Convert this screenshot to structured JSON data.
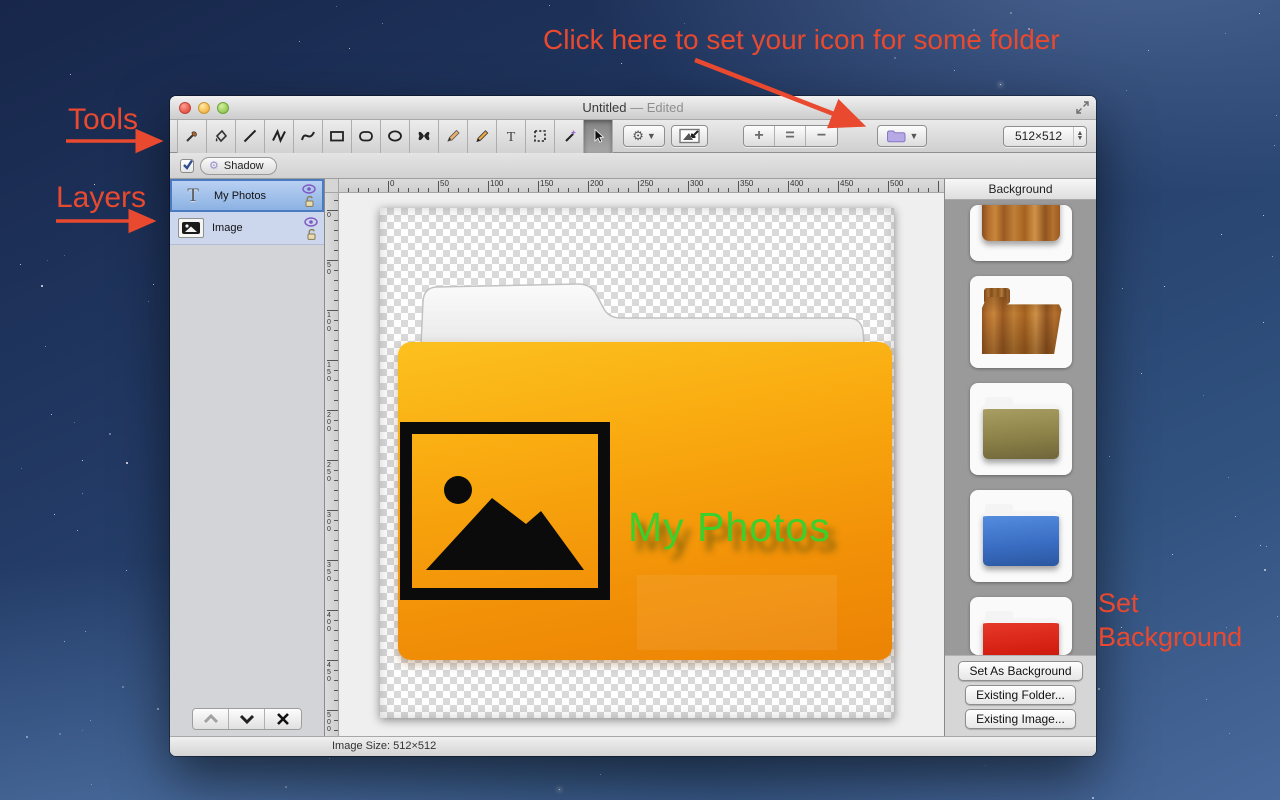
{
  "annotations": {
    "color": "#e8492f",
    "top_note": "Click here to set your icon for some folder",
    "tools_label": "Tools",
    "layers_label": "Layers",
    "set_background_label": "Set Background"
  },
  "window": {
    "title": "Untitled",
    "edited_suffix": "— Edited",
    "traffic_lights": [
      "close",
      "minimize",
      "zoom"
    ],
    "status_text": "Image Size: 512×512"
  },
  "toolbar": {
    "tools": [
      "eyedropper",
      "paint-bucket",
      "line",
      "polyline",
      "curve",
      "rectangle",
      "rounded-rectangle",
      "ellipse",
      "shapes-butterfly",
      "brush",
      "pencil",
      "text",
      "marquee-selection",
      "magic-wand",
      "move-arrow"
    ],
    "selected_tool": "move-arrow",
    "gear_menu": "gear-dropdown",
    "image_import": "image-import-button",
    "segmented_labels": [
      "+",
      "=",
      "−"
    ],
    "folder_dropdown": "folder-icon-dropdown",
    "size_value": "512×512"
  },
  "optionsbar": {
    "shadow_label": "Shadow",
    "shadow_checked": true
  },
  "layers_panel": {
    "layers": [
      {
        "name": "My Photos",
        "type": "text-layer",
        "selected": true,
        "visible": true,
        "unlocked": true
      },
      {
        "name": "Image",
        "type": "image-layer",
        "selected": false,
        "visible": true,
        "unlocked": true
      }
    ],
    "controls": [
      "move-layer-up",
      "move-layer-down",
      "delete-layer"
    ]
  },
  "canvas": {
    "ruler_ticks": [
      "0",
      "50",
      "100",
      "150",
      "200",
      "250",
      "300",
      "350",
      "400",
      "450",
      "500"
    ],
    "folder_text": "My Photos",
    "folder_text_color": "#3bd02c",
    "folder_color_top": "#fcc11f",
    "folder_color_bottom": "#ec8304"
  },
  "background_panel": {
    "title": "Background",
    "thumbnails": [
      "wood-folder-closed-partial",
      "wood-folder-open",
      "olive-folder",
      "blue-folder",
      "red-folder-partial"
    ],
    "buttons": [
      "Set As Background",
      "Existing Folder...",
      "Existing Image..."
    ]
  }
}
